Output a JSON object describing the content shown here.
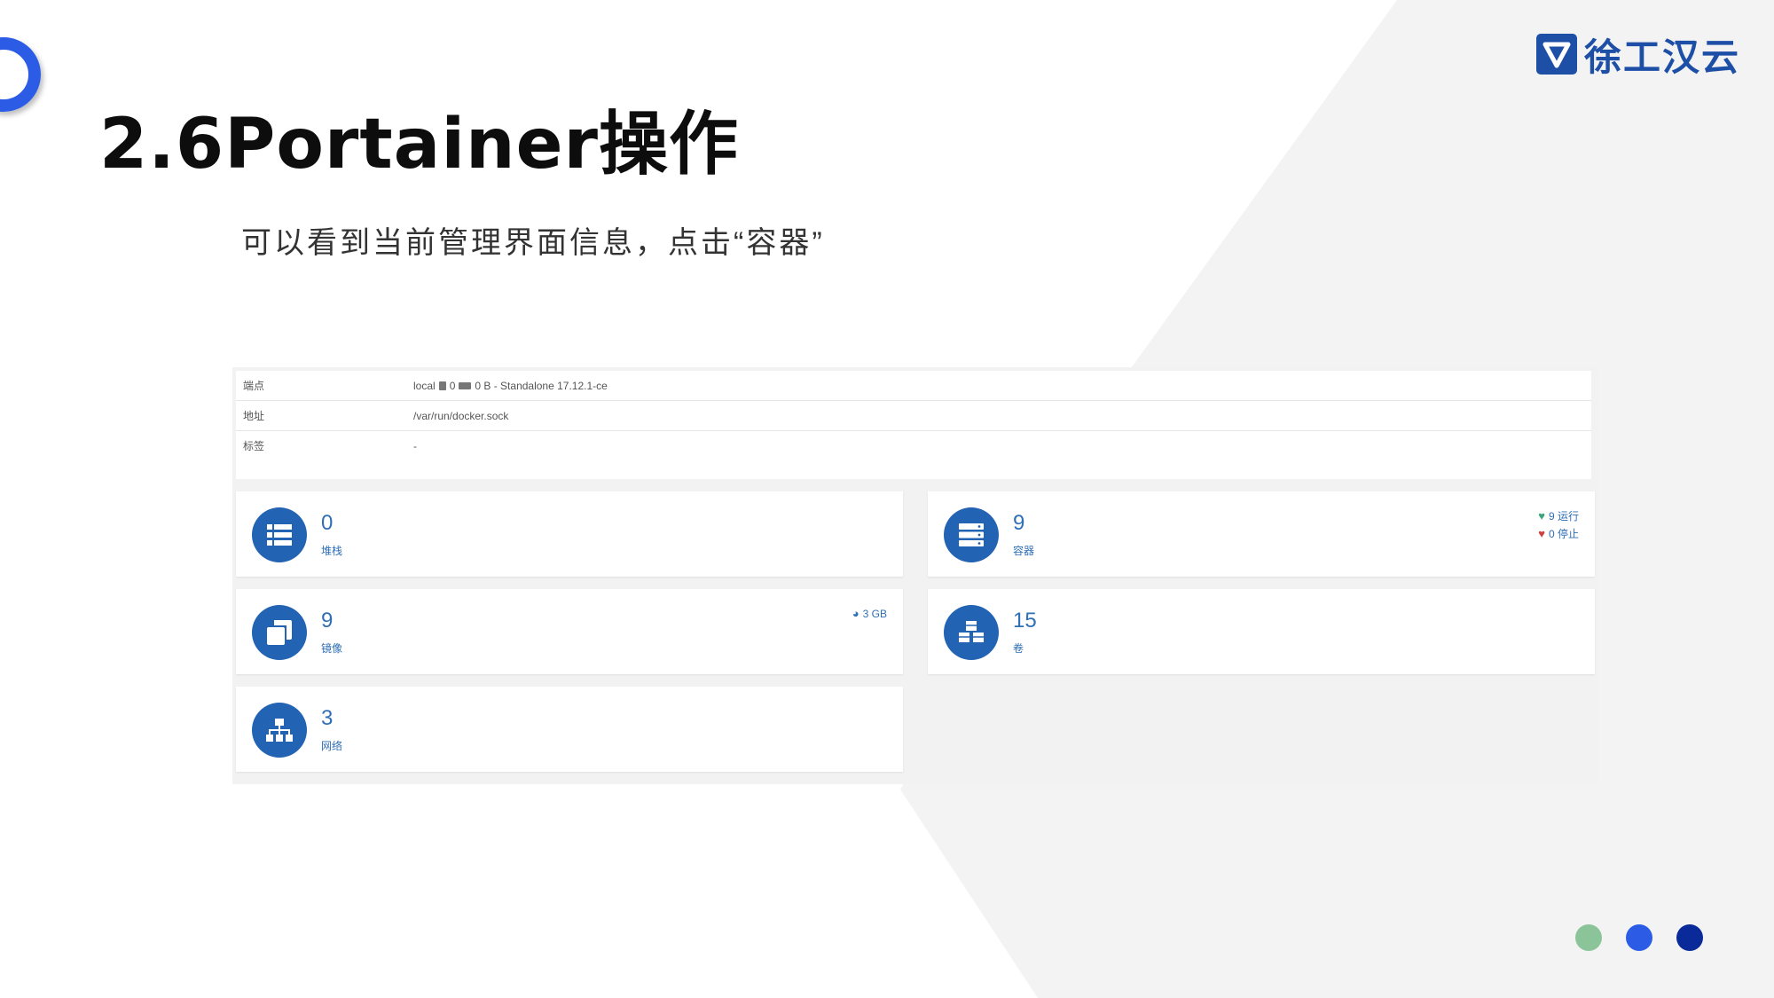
{
  "slide": {
    "title": "2.6Portainer操作",
    "subtitle": "可以看到当前管理界面信息，点击“容器”",
    "logo_text": "徐工汉云"
  },
  "endpoint_info": {
    "rows": [
      {
        "label": "端点",
        "value_name": "local",
        "cpu": "0",
        "memory": "0 B - Standalone 17.12.1-ce"
      },
      {
        "label": "地址",
        "value": "/var/run/docker.sock"
      },
      {
        "label": "标签",
        "value": "-"
      }
    ]
  },
  "tiles": {
    "stacks": {
      "count": "0",
      "label": "堆栈",
      "icon": "list-icon"
    },
    "containers": {
      "count": "9",
      "label": "容器",
      "icon": "server-icon",
      "running": "9 运行",
      "stopped": "0 停止"
    },
    "images": {
      "count": "9",
      "label": "镜像",
      "icon": "clone-icon",
      "size": "3 GB"
    },
    "volumes": {
      "count": "15",
      "label": "卷",
      "icon": "cubes-icon"
    },
    "networks": {
      "count": "3",
      "label": "网络",
      "icon": "sitemap-icon"
    }
  },
  "colors": {
    "accent": "#2363b3",
    "logo": "#1e4fa6",
    "running": "#3aa57a",
    "stopped": "#d04040",
    "dot1": "#8cc49a",
    "dot2": "#2c5ce6",
    "dot3": "#0a2a99"
  }
}
